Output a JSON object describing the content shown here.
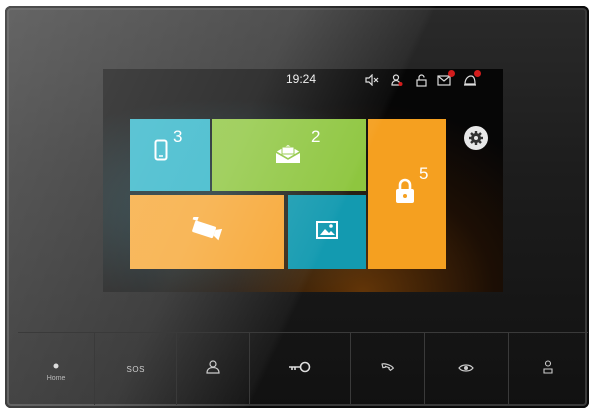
{
  "status": {
    "time": "19:24"
  },
  "tiles": {
    "phone_count": "3",
    "mail_count": "2",
    "lock_count": "5"
  },
  "bottom": {
    "home_label": "Home",
    "sos_label": "SOS"
  },
  "colors": {
    "phone_tile": "#2fb4c8",
    "mail_tile": "#8ec63f",
    "lock_tile": "#f5a020",
    "camera_tile": "#f7a735",
    "image_tile": "#139ab0",
    "badge": "#d21c1c"
  },
  "icons": {
    "status": [
      "mute-icon",
      "user-alert-icon",
      "unlock-icon",
      "mail-icon",
      "alarm-icon"
    ],
    "tiles": [
      "phone-icon",
      "envelope-icon",
      "lock-icon",
      "camera-icon",
      "picture-icon",
      "gear-icon"
    ],
    "bottom": [
      "home-icon",
      "sos",
      "person-icon",
      "key-icon",
      "handset-icon",
      "eye-icon",
      "intercom-icon"
    ]
  }
}
